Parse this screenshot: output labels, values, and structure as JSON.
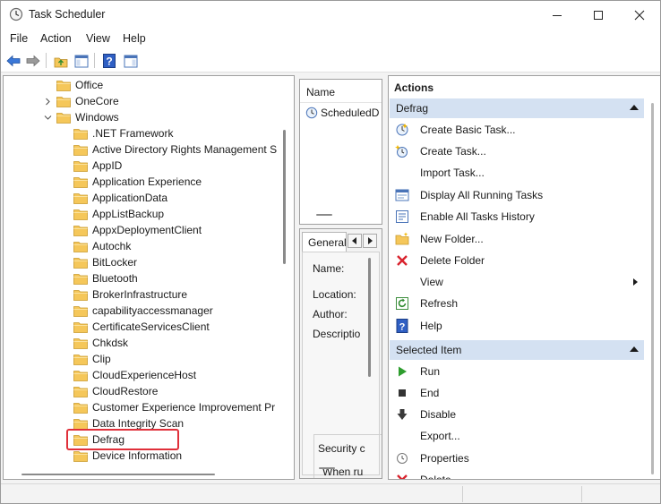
{
  "window": {
    "title": "Task Scheduler"
  },
  "menu": [
    "File",
    "Action",
    "View",
    "Help"
  ],
  "tree": {
    "items": [
      {
        "label": "Office",
        "level": 1,
        "expander": ""
      },
      {
        "label": "OneCore",
        "level": 1,
        "expander": "collapsed"
      },
      {
        "label": "Windows",
        "level": 1,
        "expander": "expanded"
      },
      {
        "label": ".NET Framework",
        "level": 2
      },
      {
        "label": "Active Directory Rights Management S",
        "level": 2
      },
      {
        "label": "AppID",
        "level": 2
      },
      {
        "label": "Application Experience",
        "level": 2
      },
      {
        "label": "ApplicationData",
        "level": 2
      },
      {
        "label": "AppListBackup",
        "level": 2
      },
      {
        "label": "AppxDeploymentClient",
        "level": 2
      },
      {
        "label": "Autochk",
        "level": 2
      },
      {
        "label": "BitLocker",
        "level": 2
      },
      {
        "label": "Bluetooth",
        "level": 2
      },
      {
        "label": "BrokerInfrastructure",
        "level": 2
      },
      {
        "label": "capabilityaccessmanager",
        "level": 2
      },
      {
        "label": "CertificateServicesClient",
        "level": 2
      },
      {
        "label": "Chkdsk",
        "level": 2
      },
      {
        "label": "Clip",
        "level": 2
      },
      {
        "label": "CloudExperienceHost",
        "level": 2
      },
      {
        "label": "CloudRestore",
        "level": 2
      },
      {
        "label": "Customer Experience Improvement Pr",
        "level": 2
      },
      {
        "label": "Data Integrity Scan",
        "level": 2
      },
      {
        "label": "Defrag",
        "level": 2,
        "selected": true
      },
      {
        "label": "Device Information",
        "level": 2
      }
    ]
  },
  "task_list": {
    "column_name": "Name",
    "rows": [
      "ScheduledD"
    ]
  },
  "details": {
    "tab": "General",
    "fields": [
      "Name:",
      "Location:",
      "Author:",
      "Descriptio"
    ],
    "security_label": "Security c",
    "when_label": "When ru"
  },
  "actions": {
    "title": "Actions",
    "sections": [
      {
        "header": "Defrag",
        "items": [
          {
            "label": "Create Basic Task...",
            "icon": "create-basic-task-icon"
          },
          {
            "label": "Create Task...",
            "icon": "create-task-icon"
          },
          {
            "label": "Import Task...",
            "icon": ""
          },
          {
            "label": "Display All Running Tasks",
            "icon": "running-tasks-icon"
          },
          {
            "label": "Enable All Tasks History",
            "icon": "tasks-history-icon"
          },
          {
            "label": "New Folder...",
            "icon": "new-folder-icon"
          },
          {
            "label": "Delete Folder",
            "icon": "delete-icon"
          },
          {
            "label": "View",
            "icon": "",
            "submenu": true
          },
          {
            "label": "Refresh",
            "icon": "refresh-icon"
          },
          {
            "label": "Help",
            "icon": "help-icon"
          }
        ]
      },
      {
        "header": "Selected Item",
        "items": [
          {
            "label": "Run",
            "icon": "run-icon"
          },
          {
            "label": "End",
            "icon": "end-icon"
          },
          {
            "label": "Disable",
            "icon": "disable-icon"
          },
          {
            "label": "Export...",
            "icon": ""
          },
          {
            "label": "Properties",
            "icon": "properties-icon"
          },
          {
            "label": "Delete",
            "icon": "delete-icon"
          }
        ]
      }
    ]
  },
  "colors": {
    "section_header": "#d4e1f2",
    "highlight": "#e0303a",
    "folder": "#f5c75a"
  }
}
